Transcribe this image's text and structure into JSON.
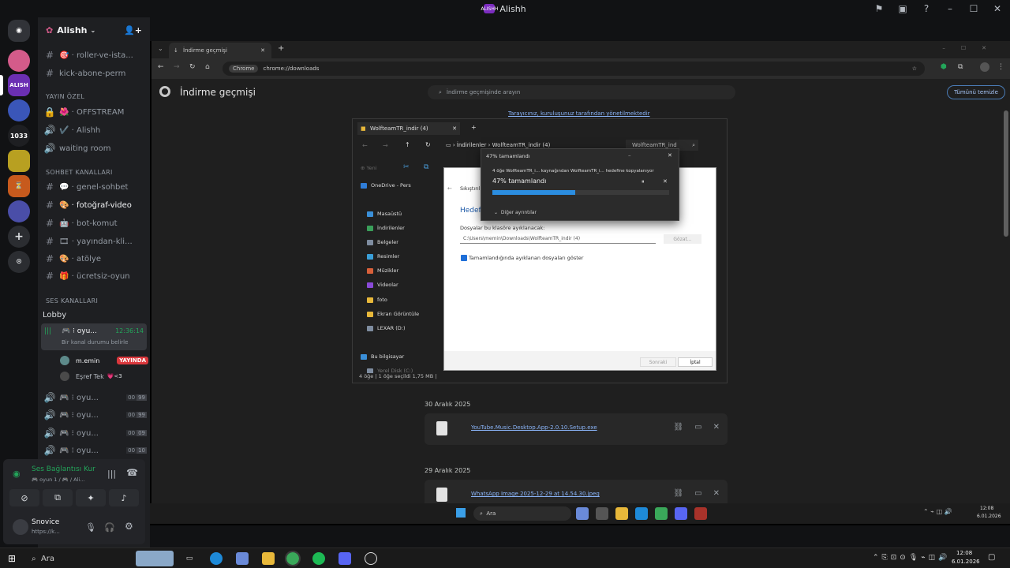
{
  "window": {
    "title": "Alishh",
    "logo_text": "ALISHH"
  },
  "titlebar_icons": [
    "inbox-icon",
    "screen-share-icon",
    "help-icon",
    "minimize-icon",
    "maximize-icon",
    "close-icon"
  ],
  "server": {
    "name": "Alishh"
  },
  "guilds": [
    {
      "label": "",
      "color": "#5865f2"
    },
    {
      "label": "",
      "color": "#d45b8a"
    },
    {
      "label": "ALISH",
      "color": "#6b2fb3"
    },
    {
      "label": "",
      "color": "#3a56b8"
    },
    {
      "label": "1033",
      "color": "#1e1f22"
    },
    {
      "label": "",
      "color": "#b8a021"
    },
    {
      "label": "",
      "color": "#c75a1d"
    },
    {
      "label": "",
      "color": "#4a4ea8"
    }
  ],
  "channels": [
    {
      "label": "🎯 · roller-ve-ista...",
      "icon": "#"
    },
    {
      "label": "kick-abone-perm",
      "icon": "#"
    }
  ],
  "categories": {
    "private": "YAYIN ÖZEL",
    "chat": "SOHBET KANALLARI",
    "voice": "SES KANALLARI"
  },
  "private_channels": [
    {
      "label": "🌺 · OFFSTREAM",
      "icon": "🔒"
    },
    {
      "label": "✔️ · Alishh",
      "icon": "🔊"
    },
    {
      "label": "waiting room",
      "icon": "🔊"
    }
  ],
  "chat_channels": [
    {
      "label": "💬 · genel-sohbet",
      "icon": "#"
    },
    {
      "label": "🎨 · fotoğraf-video",
      "icon": "#"
    },
    {
      "label": "🤖 · bot-komut",
      "icon": "#"
    },
    {
      "label": "🎞 · yayından-kli...",
      "icon": "#"
    },
    {
      "label": "🎨 · atölye",
      "icon": "#"
    },
    {
      "label": "🎁 · ücretsiz-oyun",
      "icon": "#"
    }
  ],
  "voice_channels": {
    "lobby": "Lobby",
    "active": {
      "name": "🎮 ⁝ oyu...",
      "time": "12:36:14",
      "status": "Bir kanal durumu belirle"
    },
    "members": [
      {
        "name": "m.emin",
        "badge": "YAYINDA"
      },
      {
        "name": "Eşref Tek",
        "extra": "💗<3"
      }
    ],
    "others": [
      {
        "name": "🎮 ⁝ oyu...",
        "a": "00",
        "b": "99"
      },
      {
        "name": "🎮 ⁝ oyu...",
        "a": "00",
        "b": "99"
      },
      {
        "name": "🎮 ⁝ oyu...",
        "a": "00",
        "b": "09"
      },
      {
        "name": "🎮 ⁝ oyu...",
        "a": "00",
        "b": "10"
      }
    ]
  },
  "voice_connection": {
    "title": "Ses Bağlantısı Kur",
    "subtitle": "🎮 oyun 1 / 🎮 / Ali..."
  },
  "user": {
    "name": "Snovice",
    "status": "https://k..."
  },
  "chrome": {
    "tab_title": "İndirme geçmişi",
    "chip": "Chrome",
    "url": "chrome://downloads",
    "page_title": "İndirme geçmişi",
    "search_placeholder": "İndirme geçmişinde arayın",
    "clear_all": "Tümünü temizle",
    "managed_notice": "Tarayıcınız, kuruluşunuz tarafından yönetilmektedir",
    "groups": [
      {
        "date": "30 Aralık 2025",
        "file": "YouTube.Music.Desktop.App-2.0.10.Setup.exe"
      },
      {
        "date": "29 Aralık 2025",
        "file": "WhatsApp Image 2025-12-29 at 14.54.30.jpeg"
      }
    ]
  },
  "explorer": {
    "tab_title": "WolfteamTR_indir (4)",
    "breadcrumb": [
      "İndirilenler",
      "WolfteamTR_indir (4)"
    ],
    "search": "WolfteamTR_ind",
    "new_label": "Yeni",
    "nav": [
      {
        "label": "OneDrive - Pers",
        "color": "#2f7dd8"
      },
      {
        "label": "Masaüstü",
        "color": "#3a8fd8"
      },
      {
        "label": "İndirilenler",
        "color": "#3a9f5a"
      },
      {
        "label": "Belgeler",
        "color": "#7f8da0"
      },
      {
        "label": "Resimler",
        "color": "#3a9fd8"
      },
      {
        "label": "Müzikler",
        "color": "#d8603a"
      },
      {
        "label": "Videolar",
        "color": "#8a4ad8"
      },
      {
        "label": "foto",
        "color": "#e8b83a"
      },
      {
        "label": "Ekran Görüntüle",
        "color": "#e8b83a"
      },
      {
        "label": "LEXAR (D:)",
        "color": "#7f8da0"
      },
      {
        "label": "Bu bilgisayar",
        "color": "#3a8fd8"
      },
      {
        "label": "Yerel Disk (C:)",
        "color": "#7f8da0"
      }
    ],
    "status": "4 öğe  |  1 öğe seçildi  1,75 MB  |"
  },
  "extract_dialog": {
    "heading": "Hedef",
    "label": "Dosyalar bu klasöre ayıklanacak:",
    "path": "C:\\Users\\memin\\Downloads\\WolfteamTR_indir (4)",
    "browse": "Gözat...",
    "checkbox": "Tamamlandığında ayıklanan dosyaları göster",
    "next": "Sonraki",
    "cancel": "İptal",
    "small_title": "Sıkıştırılmış"
  },
  "progress_dialog": {
    "title": "47%  tamamlandı",
    "detail": "4 öğe WolfteamTR_i... kaynağından WolfteamTR_i... hedefine kopyalanıyor",
    "percent_label": "47%  tamamlandı",
    "percent": 47,
    "more": "Diğer ayrıntılar"
  },
  "inner_taskbar": {
    "search": "Ara",
    "time": "12:08",
    "date": "6.01.2026"
  },
  "taskbar": {
    "search": "Ara",
    "time": "12:08",
    "date": "6.01.2026"
  }
}
